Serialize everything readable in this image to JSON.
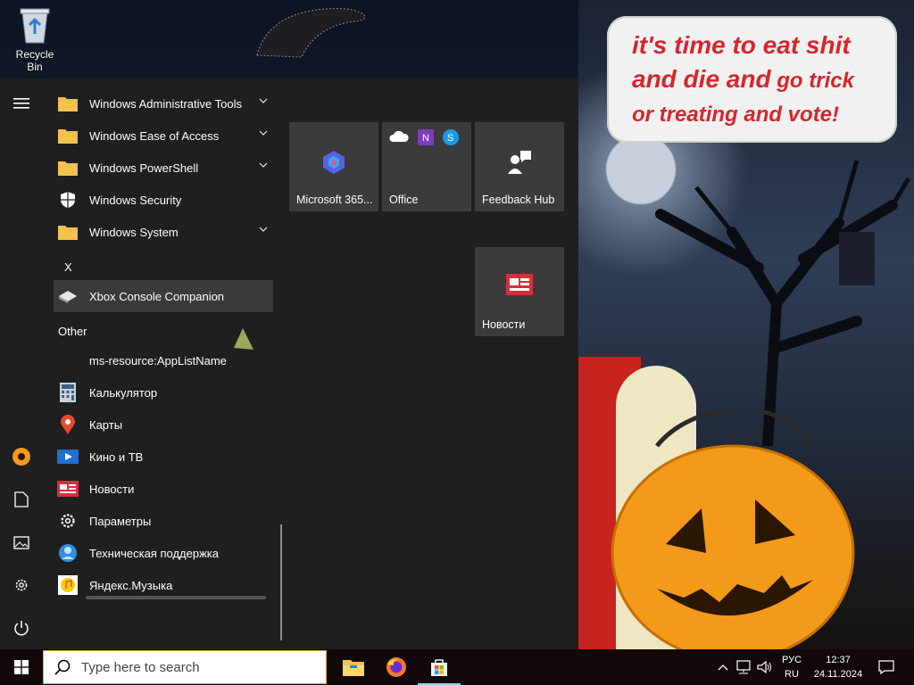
{
  "desktop": {
    "recycle_bin_label": "Recycle Bin",
    "speech_bubble": {
      "line1": "it's time to eat shit",
      "line2a": "and die and",
      "line2b": " go trick",
      "line3": "or treating and vote!"
    }
  },
  "start_menu": {
    "rail": {
      "icons": [
        "hamburger-icon",
        "user-avatar-icon",
        "documents-icon",
        "pictures-icon",
        "settings-icon",
        "power-icon"
      ]
    },
    "apps": [
      {
        "label": "Windows Administrative Tools",
        "icon": "folder-icon",
        "expandable": true
      },
      {
        "label": "Windows Ease of Access",
        "icon": "folder-icon",
        "expandable": true
      },
      {
        "label": "Windows PowerShell",
        "icon": "folder-icon",
        "expandable": true
      },
      {
        "label": "Windows Security",
        "icon": "shield-icon",
        "expandable": false
      },
      {
        "label": "Windows System",
        "icon": "folder-icon",
        "expandable": true
      }
    ],
    "letter_x": "X",
    "xbox_app": "Xbox Console Companion",
    "group_other": "Other",
    "other_apps": [
      {
        "label": "ms-resource:AppListName",
        "icon": "none"
      },
      {
        "label": "Калькулятор",
        "icon": "calculator-icon"
      },
      {
        "label": "Карты",
        "icon": "maps-icon"
      },
      {
        "label": "Кино и ТВ",
        "icon": "movies-icon"
      },
      {
        "label": "Новости",
        "icon": "news-icon"
      },
      {
        "label": "Параметры",
        "icon": "gear-icon"
      },
      {
        "label": "Техническая поддержка",
        "icon": "support-icon"
      },
      {
        "label": "Яндекс.Музыка",
        "icon": "music-icon"
      }
    ],
    "tiles": [
      {
        "label": "Microsoft 365..."
      },
      {
        "label": "Office"
      },
      {
        "label": "Feedback Hub"
      },
      {
        "label": "Новости"
      }
    ]
  },
  "taskbar": {
    "search_placeholder": "Type here to search",
    "lang_top": "РУС",
    "lang_bottom": "RU",
    "time": "12:37",
    "date": "24.11.2024"
  },
  "colors": {
    "menu_bg": "#1f1f1f",
    "tile_bg": "#3b3b3b",
    "folder": "#f2c14e",
    "accent_red": "#d6262d"
  }
}
